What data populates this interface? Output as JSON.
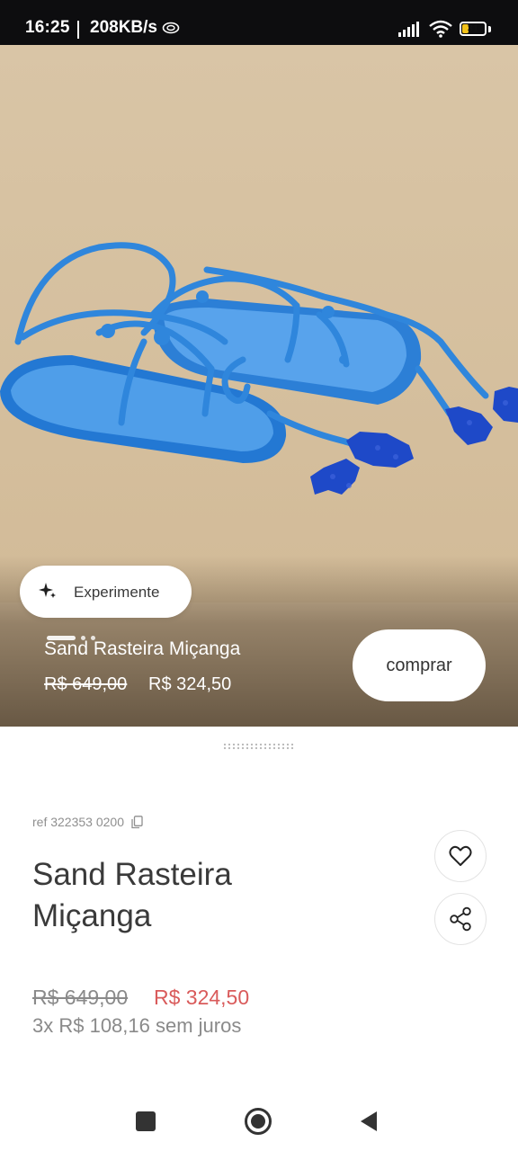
{
  "status_bar": {
    "time": "16:25",
    "network_speed": "208KB/s",
    "battery_level": "31",
    "icons": [
      "data-saver-icon",
      "signal-icon",
      "wifi-icon",
      "battery-icon"
    ]
  },
  "hero": {
    "try_on_label": "Experimente",
    "product_name": "Sand Rasteira Miçanga",
    "old_price": "R$ 649,00",
    "new_price": "R$ 324,50",
    "buy_label": "comprar",
    "carousel_dots": 3,
    "active_dot": 0
  },
  "details": {
    "ref": "ref 322353 0200",
    "title": "Sand Rasteira Miçanga",
    "old_price": "R$ 649,00",
    "new_price": "R$ 324,50",
    "installments": "3x R$ 108,16 sem juros"
  },
  "colors": {
    "hero_background": "#d6c0a0",
    "sale_price": "#d95b5b",
    "muted_text": "#8a8a8a",
    "title_text": "#3a3a3a",
    "product_blue": "#2f86dc"
  },
  "icons": [
    "sparkle-icon",
    "copy-icon",
    "heart-icon",
    "share-icon",
    "square-icon",
    "circle-icon",
    "back-triangle-icon"
  ]
}
